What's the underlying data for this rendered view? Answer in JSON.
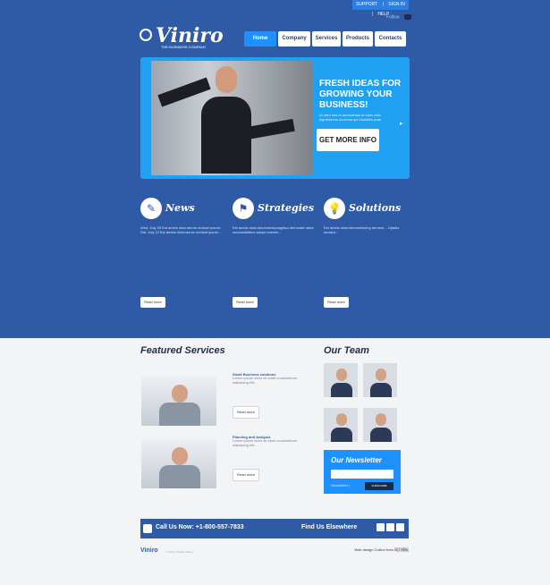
{
  "utility": {
    "support": "SUPPORT",
    "signin": "SIGN IN",
    "help": "HELP",
    "sep": "|"
  },
  "top_right": {
    "text": "Follow"
  },
  "logo": {
    "name": "Viniro",
    "tagline": "THE BUSINESS COMPANY"
  },
  "nav": [
    "Home",
    "Company",
    "Services",
    "Products",
    "Contacts"
  ],
  "hero": {
    "title": "FRESH IDEAS FOR GROWING YOUR BUSINESS!",
    "small": "At vero eos et accusamus et iusto odio dignissimos ducimus qui blanditiis prae",
    "button": "GET MORE INFO"
  },
  "columns": {
    "news": {
      "title": "News",
      "text": "Wed, July 28  Est ameis dolornerum obdiunt ipsum... Sat, July 12  Est ameis dolornerum obdiunt ipsum...",
      "button": "Read more"
    },
    "strategies": {
      "title": "Strategies",
      "text": "Est ameis dolornerumobsxpuqqfsul dernorate adas necessitatibus saepe eveniet...",
      "button": "Read more"
    },
    "solutions": {
      "title": "Solutions",
      "text": "Est ameis dolornerumobisimg derume... Uptatis secatur...",
      "button": "Read more"
    }
  },
  "featured": {
    "title": "Featured Services",
    "items": [
      {
        "title": "Small Business solutions",
        "text": "Lorem ipsum dolor sit amet consectetuer adipiscing elit...",
        "button": "Read more"
      },
      {
        "title": "Planning and Analysis",
        "text": "Lorem ipsum dolor sit amet consectetuer adipiscing elit...",
        "button": "Read more"
      }
    ]
  },
  "team": {
    "title": "Our Team"
  },
  "newsletter": {
    "title": "Our Newsletter",
    "label": "Newsletter  |",
    "button": "SUBSCRIBE"
  },
  "footer": {
    "call": "Call Us Now: +1-800-557-7833",
    "find": "Find Us Elsewhere"
  },
  "bottom": {
    "brand": "Viniro",
    "copy": "© 2013 | Privacy Policy",
    "right": "Web design Collect from 网页模板"
  }
}
